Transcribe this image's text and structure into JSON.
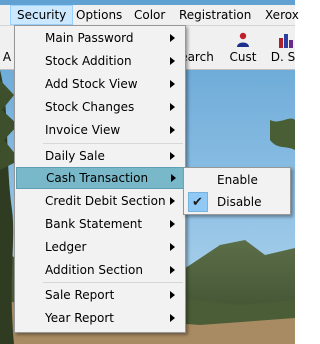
{
  "menubar": {
    "items": [
      {
        "label": "Security"
      },
      {
        "label": "Options"
      },
      {
        "label": "Color"
      },
      {
        "label": "Registration"
      },
      {
        "label": "Xerox"
      }
    ]
  },
  "toolbar": {
    "buttons": [
      {
        "label": "A"
      },
      {
        "label": "earch"
      },
      {
        "label": "Cust"
      },
      {
        "label": "D. S"
      }
    ]
  },
  "security_menu": {
    "items": [
      {
        "label": "Main Password"
      },
      {
        "label": "Stock Addition"
      },
      {
        "label": "Add Stock View"
      },
      {
        "label": "Stock Changes"
      },
      {
        "label": "Invoice View"
      },
      {
        "label": "Daily Sale"
      },
      {
        "label": "Cash Transaction"
      },
      {
        "label": "Credit Debit Section"
      },
      {
        "label": "Bank Statement"
      },
      {
        "label": "Ledger"
      },
      {
        "label": "Addition Section"
      },
      {
        "label": "Sale Report"
      },
      {
        "label": "Year Report"
      }
    ],
    "highlighted": "Cash Transaction"
  },
  "cash_transaction_submenu": {
    "items": [
      {
        "label": "Enable",
        "checked": false
      },
      {
        "label": "Disable",
        "checked": true
      }
    ]
  }
}
